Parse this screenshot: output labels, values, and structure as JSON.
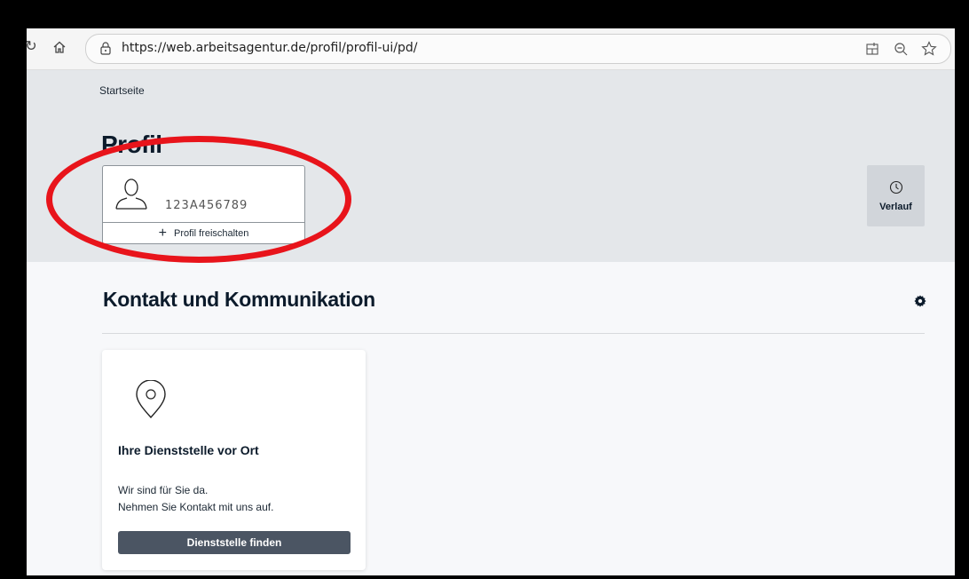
{
  "browser": {
    "url": "https://web.arbeitsagentur.de/profil/profil-ui/pd/"
  },
  "header": {
    "breadcrumb": "Startseite",
    "title": "Profil",
    "profile_id": "123A456789",
    "unlock_label": "Profil freischalten",
    "history_label": "Verlauf"
  },
  "contact": {
    "title": "Kontakt und Kommunikation",
    "card": {
      "title": "Ihre Dienststelle vor Ort",
      "line1": "Wir sind für Sie da.",
      "line2": "Nehmen Sie Kontakt mit uns auf.",
      "button": "Dienststelle finden"
    }
  },
  "colors": {
    "annotation": "#e8141b",
    "header_bg": "#e4e7ea",
    "button_bg": "#4b5563"
  },
  "icons": [
    "reload-icon",
    "home-icon",
    "lock-icon",
    "tab-icon",
    "zoom-icon",
    "favorite-icon",
    "user-icon",
    "plus-icon",
    "clock-icon",
    "gear-icon",
    "location-pin-icon"
  ]
}
